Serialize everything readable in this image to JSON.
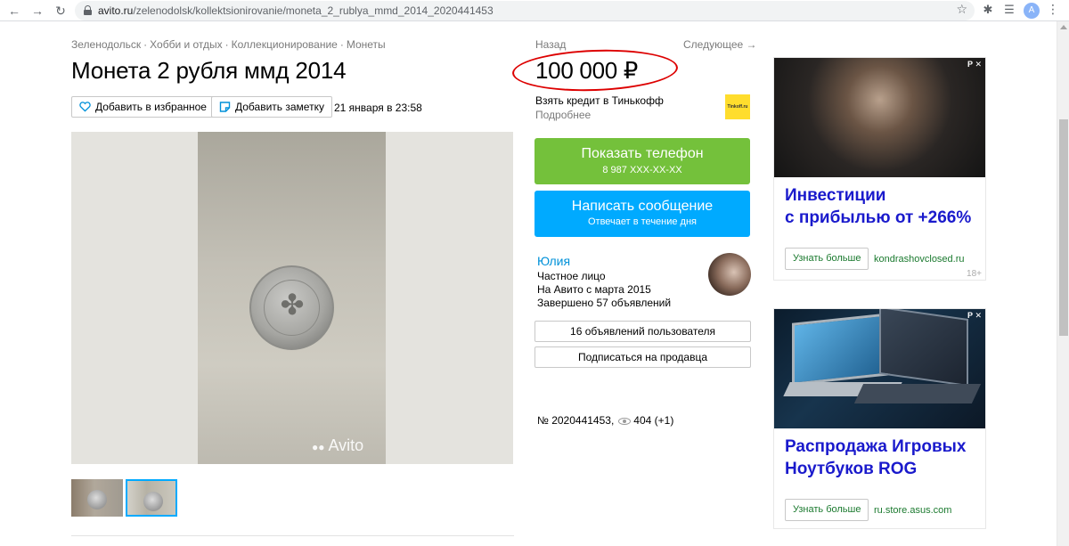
{
  "browser": {
    "url_domain": "avito.ru",
    "url_path": "/zelenodolsk/kollektsionirovanie/moneta_2_rublya_mmd_2014_2020441453",
    "profile_initial": "A"
  },
  "breadcrumbs": [
    "Зеленодольск",
    "Хобби и отдых",
    "Коллекционирование",
    "Монеты"
  ],
  "listing": {
    "title": "Монета 2 рубля ммд 2014",
    "favorite_label": "Добавить в избранное",
    "note_label": "Добавить заметку",
    "date": "21 января в 23:58",
    "watermark": "Avito",
    "item_number": "№ 2020441453,",
    "views": "404 (+1)"
  },
  "nav": {
    "back": "Назад",
    "next": "Следующее →"
  },
  "price": {
    "value": "100 000 ₽",
    "credit": "Взять кредит в Тинькофф",
    "credit_more": "Подробнее",
    "bank_logo_text": "Tinkoff.ru"
  },
  "contact": {
    "phone_label": "Показать телефон",
    "phone_mask": "8 987 XXX-XX-XX",
    "message_label": "Написать сообщение",
    "message_sub": "Отвечает в течение дня"
  },
  "seller": {
    "name": "Юлия",
    "type": "Частное лицо",
    "since": "На Авито с марта 2015",
    "completed": "Завершено 57 объявлений",
    "ads_button": "16 объявлений пользователя",
    "subscribe_button": "Подписаться на продавца"
  },
  "ads": [
    {
      "mark": "Р ✕",
      "heading_line1": "Инвестиции",
      "heading_line2": "с прибылью от +266%",
      "button": "Узнать больше",
      "domain": "kondrashovclosed.ru",
      "age": "18+"
    },
    {
      "mark": "Р ✕",
      "heading_line1": "Распродажа Игровых",
      "heading_line2": "Ноутбуков ROG",
      "button": "Узнать больше",
      "domain": "ru.store.asus.com"
    }
  ],
  "colors": {
    "accent_green": "#74c13b",
    "accent_blue": "#00aaff",
    "link_blue": "#0091d9",
    "ad_heading": "#1a1acc",
    "annotation_red": "#dd0000"
  }
}
